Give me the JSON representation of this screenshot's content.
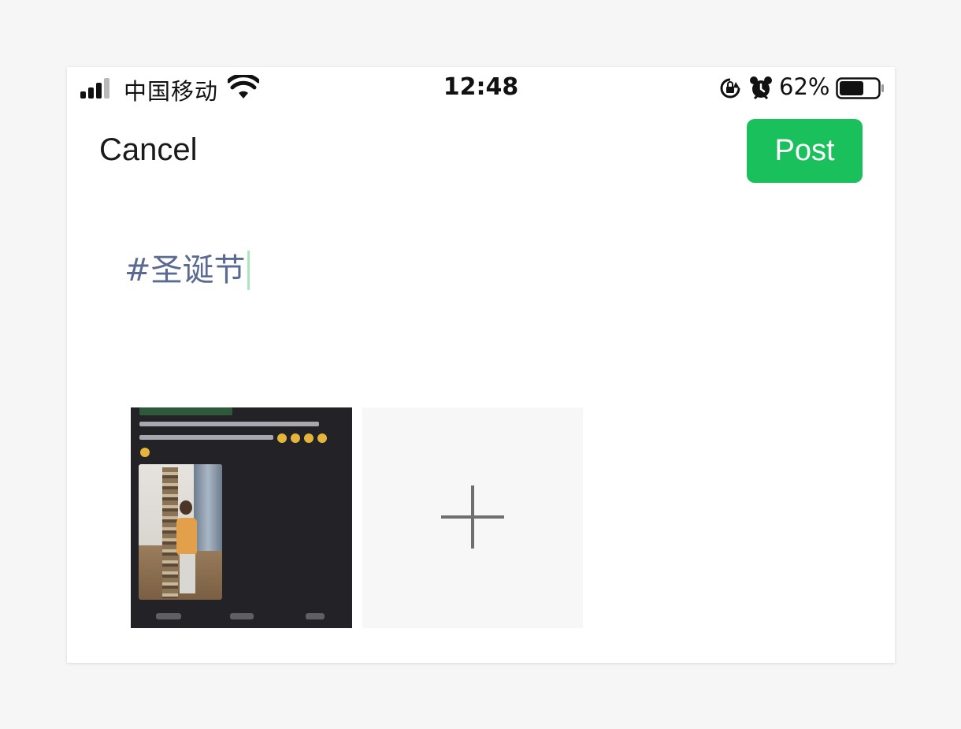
{
  "status_bar": {
    "carrier": "中国移动",
    "time": "12:48",
    "battery_percent": "62%",
    "battery_level": 0.62,
    "icons": [
      "signal-icon",
      "wifi-icon",
      "orientation-lock-icon",
      "alarm-icon",
      "battery-icon"
    ]
  },
  "header": {
    "cancel_label": "Cancel",
    "post_label": "Post",
    "accent_color": "#1ac05c"
  },
  "compose": {
    "text": "#圣诞节",
    "text_color": "#5a6a91"
  },
  "media": {
    "attachments": [
      {
        "type": "image",
        "description": "screenshot-thumbnail"
      }
    ],
    "add_tile_icon": "plus-icon"
  }
}
